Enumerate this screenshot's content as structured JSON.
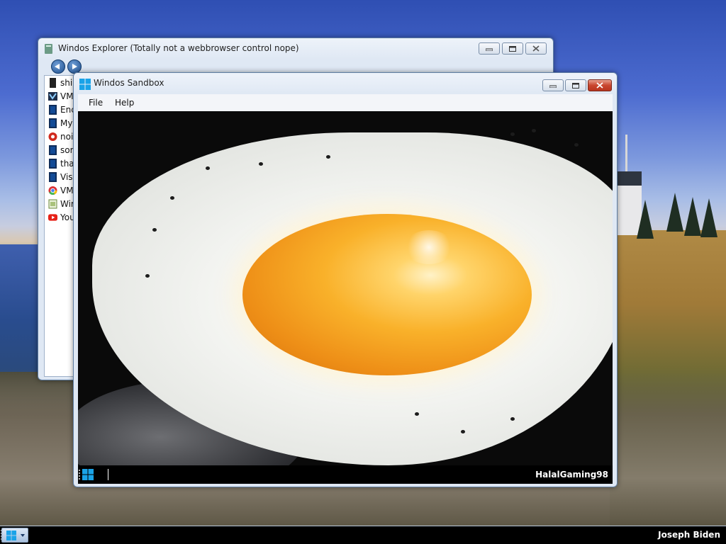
{
  "explorer": {
    "title": "Windos Explorer (Totally not a webbrowser control nope)",
    "items": [
      {
        "label": "shi",
        "icon": "black-file-icon"
      },
      {
        "label": "VM",
        "icon": "vm-icon"
      },
      {
        "label": "Enc",
        "icon": "app-icon"
      },
      {
        "label": "My",
        "icon": "app-icon"
      },
      {
        "label": "noi",
        "icon": "red-spiral-icon"
      },
      {
        "label": "sor",
        "icon": "app-icon"
      },
      {
        "label": "tha",
        "icon": "app-icon"
      },
      {
        "label": "Vis",
        "icon": "app-icon"
      },
      {
        "label": "VM",
        "icon": "chrome-icon"
      },
      {
        "label": "Wir",
        "icon": "window-icon"
      },
      {
        "label": "You",
        "icon": "youtube-icon"
      }
    ]
  },
  "sandbox": {
    "title": "Windos Sandbox",
    "menu": {
      "file": "File",
      "help": "Help"
    },
    "taskbar_user": "HalalGaming98"
  },
  "taskbar": {
    "user_name": "Joseph Biden"
  },
  "colors": {
    "accent": "#1aa3e8",
    "titlebar": "#dfe8f4",
    "close": "#c9462f"
  }
}
